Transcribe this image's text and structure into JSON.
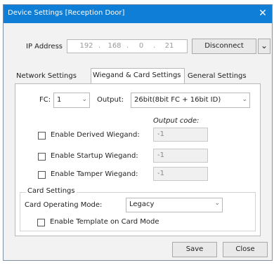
{
  "window": {
    "title": "Device Settings [Reception Door]",
    "close_glyph": "✕"
  },
  "connection": {
    "ip_label": "IP Address",
    "ip_octets": [
      "192",
      "168",
      "0",
      "21"
    ],
    "disconnect_label": "Disconnect",
    "dropdown_glyph": "⌄"
  },
  "tabs": [
    {
      "label": "Network Settings",
      "active": false
    },
    {
      "label": "Wiegand & Card Settings",
      "active": true
    },
    {
      "label": "General Settings",
      "active": false
    }
  ],
  "wiegand": {
    "fc_label": "FC:",
    "fc_value": "1",
    "output_label": "Output:",
    "output_value": "26bit(8bit FC + 16bit ID)",
    "output_code_header": "Output code:",
    "options": [
      {
        "label": "Enable Derived Wiegand:",
        "checked": false,
        "code": "-1"
      },
      {
        "label": "Enable Startup Wiegand:",
        "checked": false,
        "code": "-1"
      },
      {
        "label": "Enable Tamper Wiegand:",
        "checked": false,
        "code": "-1"
      }
    ]
  },
  "card_settings": {
    "group_label": "Card Settings",
    "mode_label": "Card Operating Mode:",
    "mode_value": "Legacy",
    "template_label": "Enable Template on Card Mode",
    "template_checked": false
  },
  "footer": {
    "save_label": "Save",
    "close_label": "Close"
  },
  "colors": {
    "titlebar": "#0f7ed6",
    "window_bg": "#f2f2f2"
  }
}
